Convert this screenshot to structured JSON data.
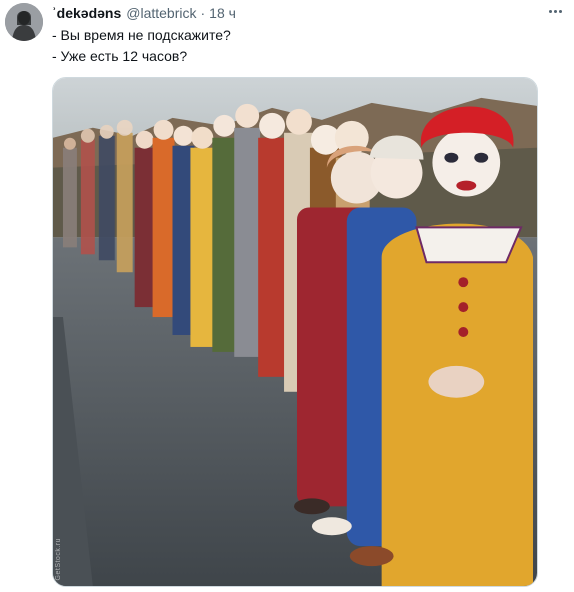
{
  "tweet": {
    "author": {
      "display_name": "ʾdekədəns",
      "handle": "@lattebrick",
      "separator": "·",
      "time": "18 ч"
    },
    "text_lines": [
      "- Вы время не подскажите?",
      "- Уже есть 12 часов?"
    ],
    "media": {
      "watermark": "GetStock.ru"
    },
    "icons": {
      "more": "more-horizontal-icon",
      "avatar": "user-avatar"
    }
  }
}
